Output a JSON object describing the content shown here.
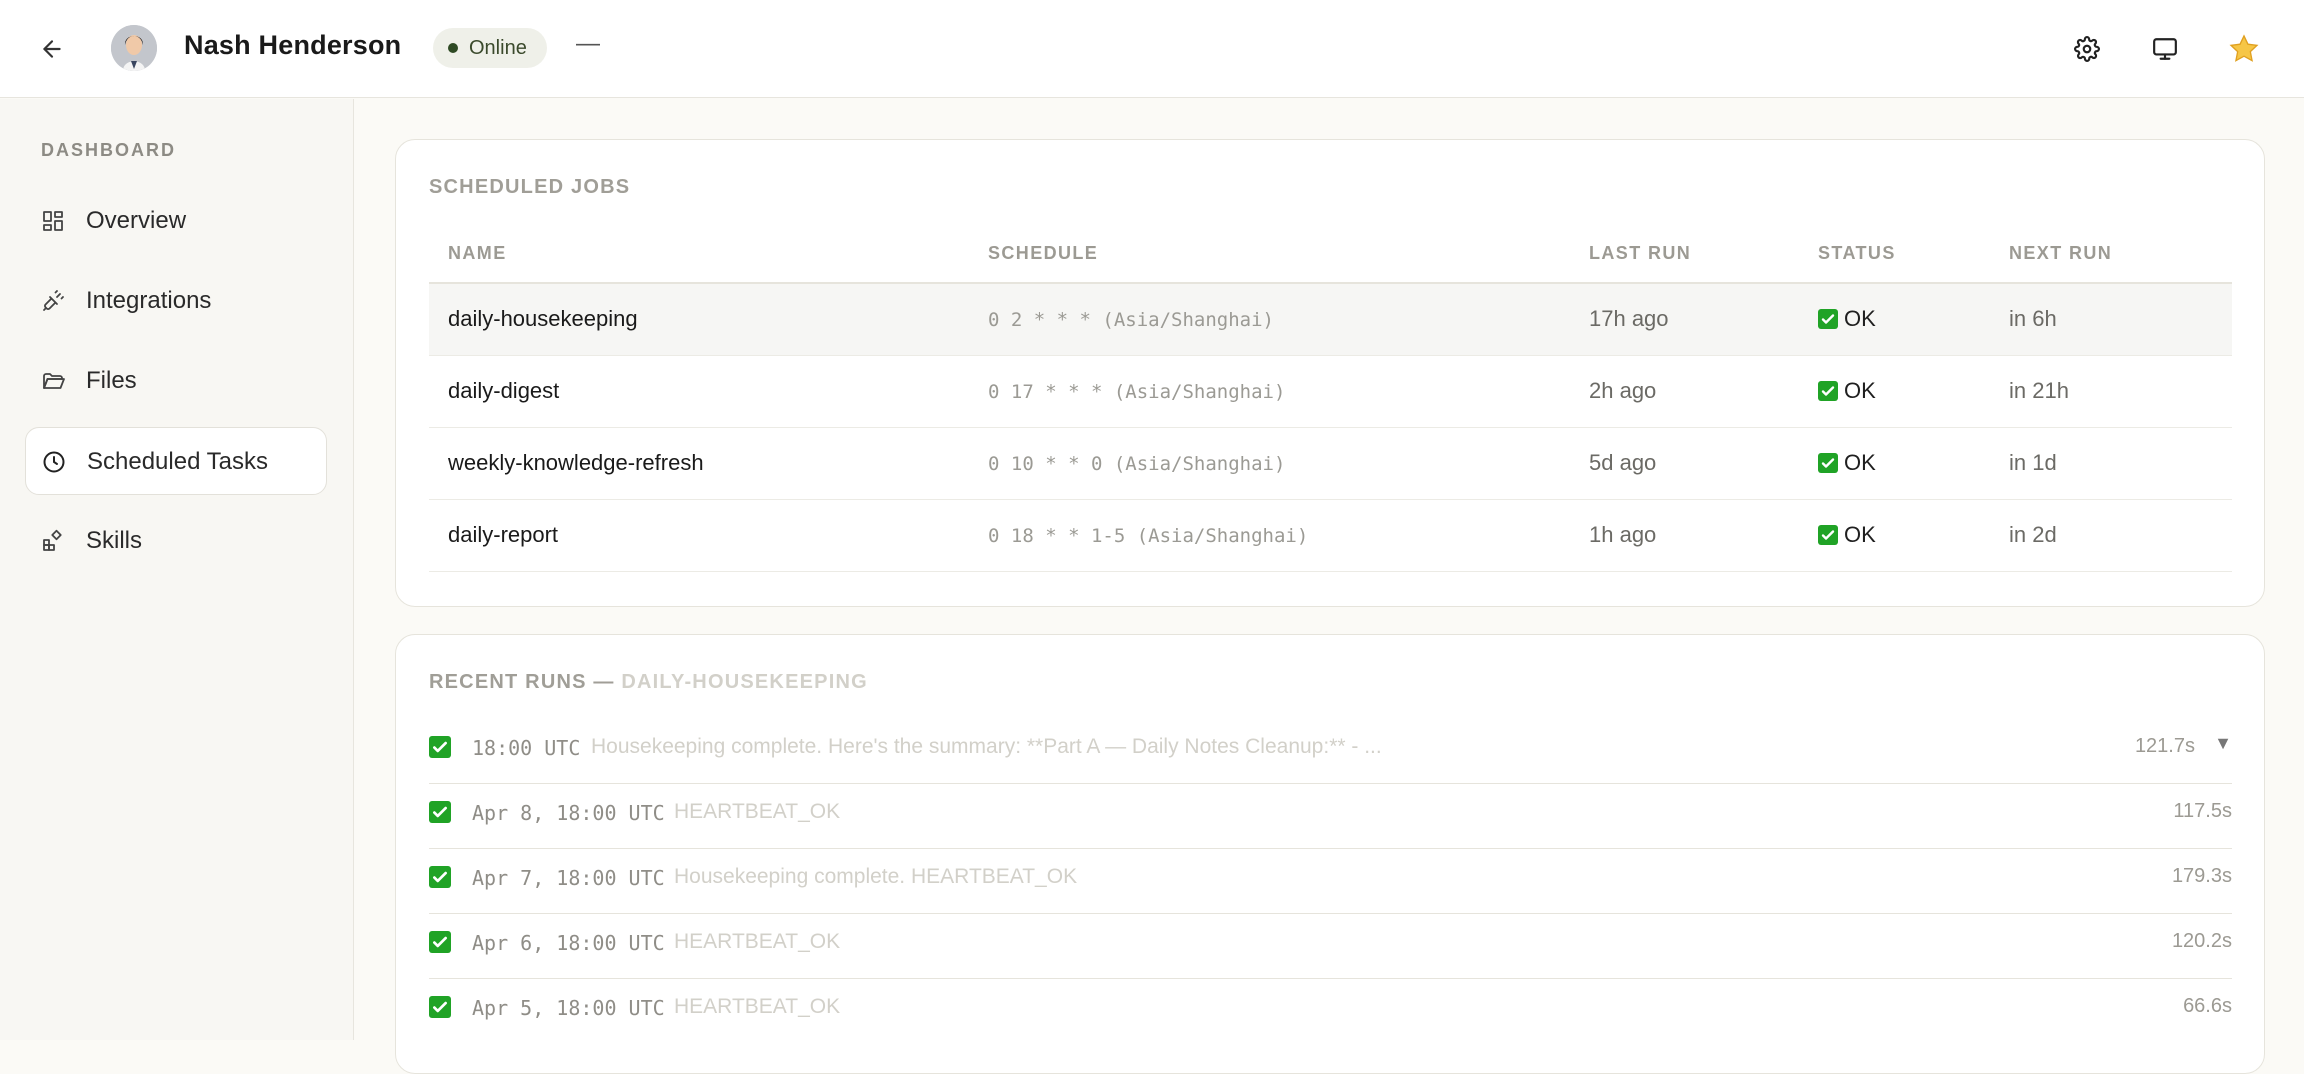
{
  "header": {
    "user_name": "Nash Henderson",
    "status": "Online",
    "separator": "—",
    "icons": [
      "back-arrow-icon",
      "gear-icon",
      "monitor-icon",
      "star-icon"
    ]
  },
  "sidebar": {
    "heading": "DASHBOARD",
    "items": [
      {
        "label": "Overview",
        "icon": "grid-icon"
      },
      {
        "label": "Integrations",
        "icon": "plug-icon"
      },
      {
        "label": "Files",
        "icon": "folder-icon"
      },
      {
        "label": "Scheduled Tasks",
        "icon": "clock-icon",
        "active": true
      },
      {
        "label": "Skills",
        "icon": "blocks-icon"
      }
    ]
  },
  "jobs": {
    "title": "SCHEDULED JOBS",
    "columns": [
      "NAME",
      "SCHEDULE",
      "LAST RUN",
      "STATUS",
      "NEXT RUN"
    ],
    "rows": [
      {
        "name": "daily-housekeeping",
        "schedule": "0 2 * * * (Asia/Shanghai)",
        "last_run": "17h ago",
        "status": "OK",
        "next_run": "in 6h"
      },
      {
        "name": "daily-digest",
        "schedule": "0 17 * * * (Asia/Shanghai)",
        "last_run": "2h ago",
        "status": "OK",
        "next_run": "in 21h"
      },
      {
        "name": "weekly-knowledge-refresh",
        "schedule": "0 10 * * 0 (Asia/Shanghai)",
        "last_run": "5d ago",
        "status": "OK",
        "next_run": "in 1d"
      },
      {
        "name": "daily-report",
        "schedule": "0 18 * * 1-5 (Asia/Shanghai)",
        "last_run": "1h ago",
        "status": "OK",
        "next_run": "in 2d"
      }
    ]
  },
  "runs": {
    "title": "RECENT RUNS —",
    "title_job": "DAILY-HOUSEKEEPING",
    "rows": [
      {
        "time": "18:00 UTC",
        "message": "Housekeeping complete. Here's the summary: **Part A — Daily Notes Cleanup:** - ...",
        "duration": "121.7s",
        "caret": "▼"
      },
      {
        "time": "Apr 8, 18:00 UTC",
        "message": "HEARTBEAT_OK",
        "duration": "117.5s"
      },
      {
        "time": "Apr 7, 18:00 UTC",
        "message": "Housekeeping complete. HEARTBEAT_OK",
        "duration": "179.3s"
      },
      {
        "time": "Apr 6, 18:00 UTC",
        "message": "HEARTBEAT_OK",
        "duration": "120.2s"
      },
      {
        "time": "Apr 5, 18:00 UTC",
        "message": "HEARTBEAT_OK",
        "duration": "66.6s"
      }
    ]
  },
  "colors": {
    "ok_green": "#20a326",
    "accent_dark": "#2f4a24",
    "star": "#f4c430"
  }
}
